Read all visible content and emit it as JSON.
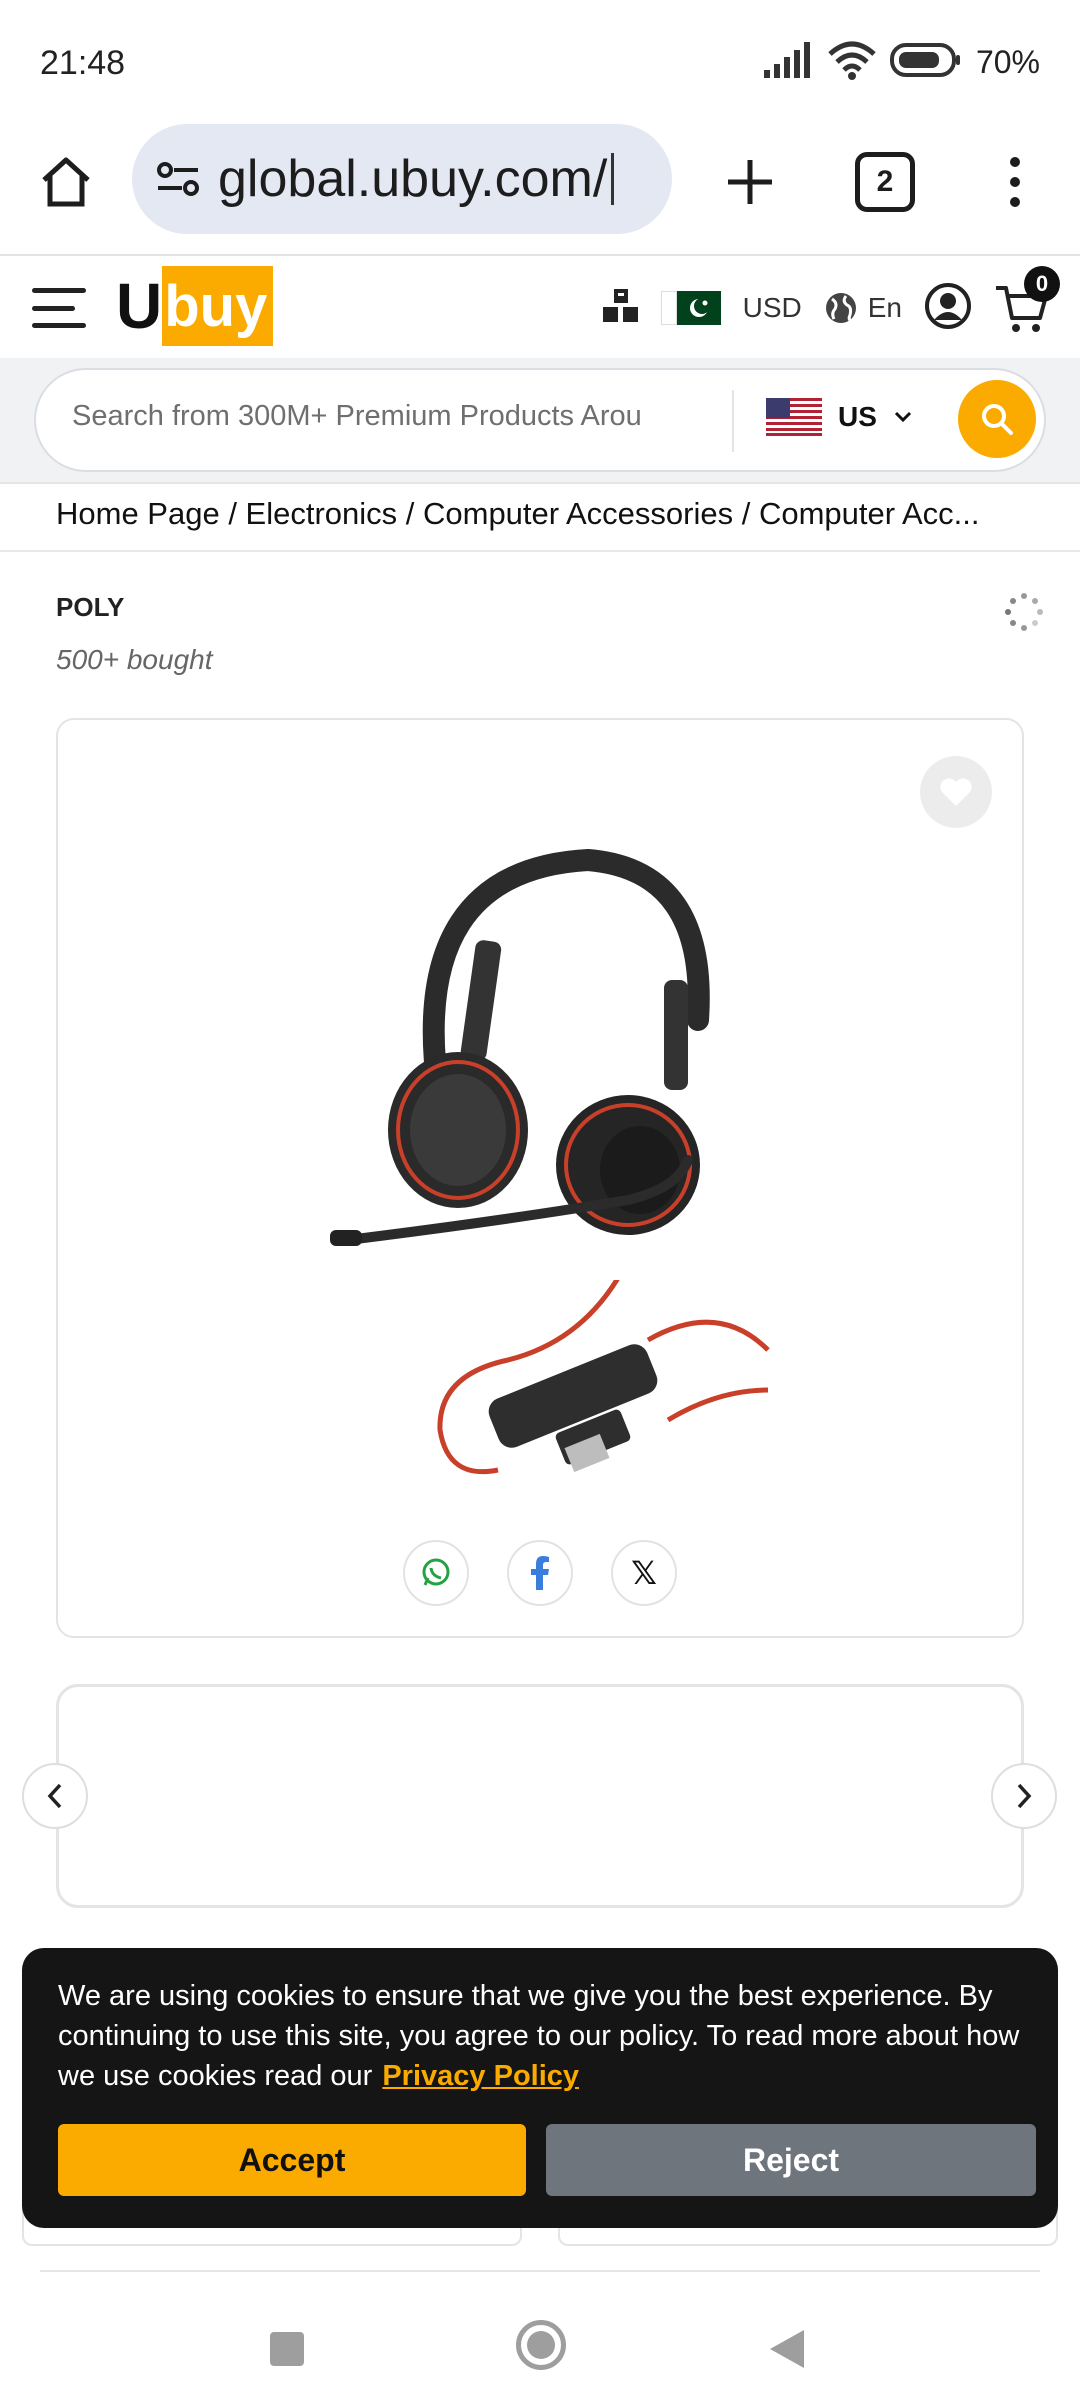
{
  "status_bar": {
    "time": "21:48",
    "battery": "70%"
  },
  "browser": {
    "url": "global.ubuy.com/",
    "tab_count": "2"
  },
  "header": {
    "logo_u": "U",
    "logo_buy": "buy",
    "currency": "USD",
    "language": "En",
    "cart_count": "0"
  },
  "search": {
    "placeholder": "Search from 300M+ Premium Products Arou",
    "country": "US"
  },
  "breadcrumb": "Home Page / Electronics / Computer Accessories / Computer Acc...",
  "product": {
    "brand": "POLY",
    "bought": "500+ bought"
  },
  "cookie": {
    "message": "We are using cookies to ensure that we give you the best experience. By continuing to use this site, you agree to our policy. To read more about how we use cookies read our",
    "privacy_link": "Privacy Policy",
    "accept_label": "Accept",
    "reject_label": "Reject"
  },
  "icons": {
    "share": [
      "whatsapp-icon",
      "facebook-icon",
      "x-icon"
    ]
  },
  "colors": {
    "brand_yellow": "#fbab00",
    "cookie_bg": "#151515",
    "reject_gray": "#6e757d"
  }
}
